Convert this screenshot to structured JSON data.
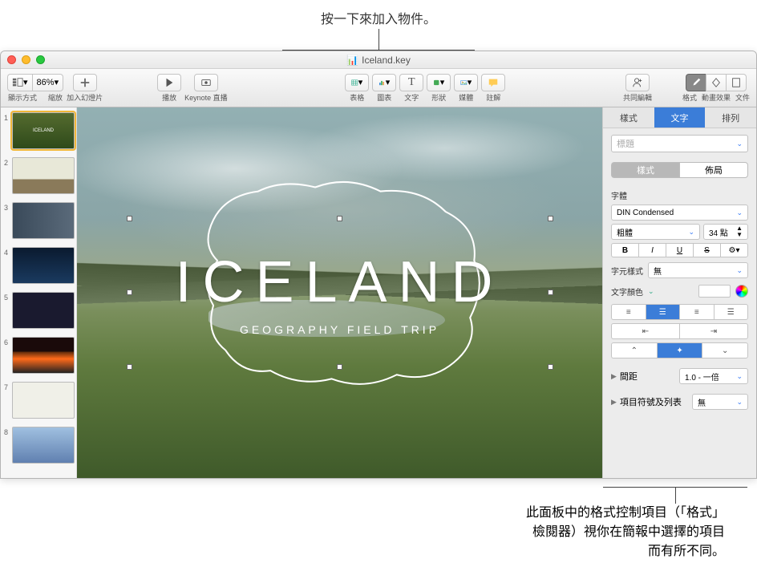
{
  "annotations": {
    "top": "按一下來加入物件。",
    "bottom_l1": "此面板中的格式控制項目（「格式」",
    "bottom_l2": "檢閱器）視你在簡報中選擇的項目",
    "bottom_l3": "而有所不同。"
  },
  "title": {
    "filename": "Iceland.key"
  },
  "toolbar": {
    "view": "顯示方式",
    "zoom_val": "86%",
    "zoom": "縮放",
    "add_slide": "加入幻燈片",
    "play": "播放",
    "rehearse": "Keynote 直播",
    "table": "表格",
    "chart": "圖表",
    "text": "文字",
    "shape": "形狀",
    "media": "媒體",
    "comment": "註解",
    "collab": "共同編輯",
    "format": "格式",
    "animation": "動畫效果",
    "document": "文件"
  },
  "slide": {
    "title": "ICELAND",
    "subtitle": "GEOGRAPHY FIELD TRIP"
  },
  "thumbs": [
    "1",
    "2",
    "3",
    "4",
    "5",
    "6",
    "7",
    "8"
  ],
  "thumb_labels": {
    "t1": "ICELAND"
  },
  "inspector": {
    "tabs": {
      "style": "樣式",
      "text": "文字",
      "arrange": "排列"
    },
    "paragraph_style": "標題",
    "seg": {
      "style": "樣式",
      "layout": "佈局"
    },
    "font_label": "字體",
    "font": "DIN Condensed",
    "weight": "粗體",
    "size": "34 點",
    "bold": "B",
    "italic": "I",
    "underline": "U",
    "strike": "S",
    "char_style_label": "字元樣式",
    "char_style": "無",
    "text_color_label": "文字顏色",
    "spacing_label": "間距",
    "spacing_value": "1.0 - 一倍",
    "bullets_label": "項目符號及列表",
    "bullets_value": "無"
  }
}
